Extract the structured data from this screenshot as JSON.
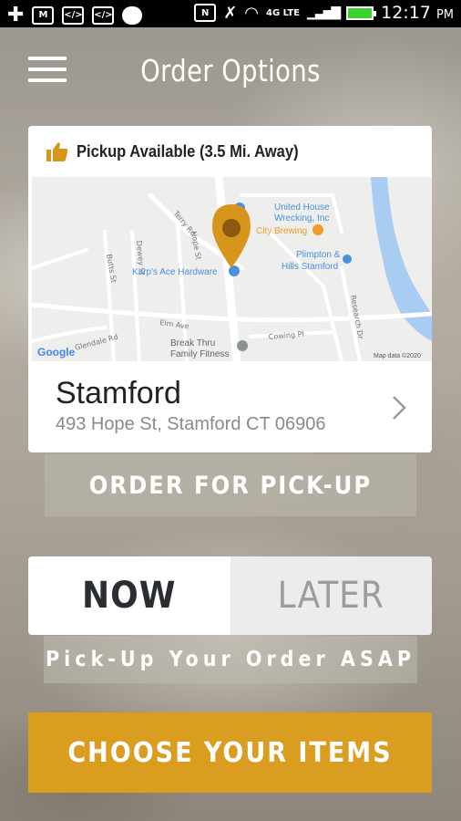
{
  "status_bar": {
    "time": "12:17",
    "ampm": "PM",
    "network": "4G LTE"
  },
  "header": {
    "title": "Order Options"
  },
  "location_card": {
    "pickup_label": "Pickup Available (3.5 Mi. Away)",
    "name": "Stamford",
    "address": "493 Hope St, Stamford CT 06906",
    "map": {
      "labels": {
        "united_house": "United House",
        "wrecking": "Wrecking, Inc",
        "city_brewing": "City Brewing",
        "plimpton": "Plimpton &",
        "hills_stamford": "Hills Stamford",
        "karps": "Karp's Ace Hardware",
        "break_thru": "Break Thru",
        "family_fitness": "Family Fitness",
        "google": "Google",
        "map_data": "Map data ©2020",
        "street_terry": "Terry Rd",
        "street_butts": "Butts St",
        "street_dewey": "Dewey St",
        "street_hope": "Hope St",
        "street_elm": "Elm Ave",
        "street_glendale": "Glendale Rd",
        "street_cowing": "Cowing Pl",
        "street_research": "Research Dr"
      },
      "colors": {
        "pin": "#d8951c",
        "water": "#a9cdf2",
        "poi_blue": "#4a8fe0",
        "poi_orange": "#f19a2a"
      }
    }
  },
  "buttons": {
    "order_pickup": "ORDER FOR PICK-UP",
    "choose_items": "CHOOSE YOUR ITEMS"
  },
  "timing": {
    "now": "NOW",
    "later": "LATER",
    "selected": "NOW",
    "caption": "Pick-Up Your Order ASAP"
  },
  "colors": {
    "accent": "#db9d1f",
    "text_dark": "#2a2e33"
  }
}
